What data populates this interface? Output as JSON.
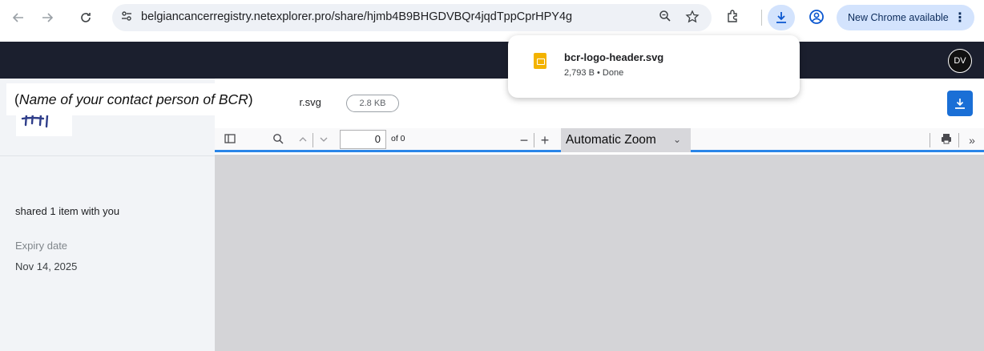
{
  "browser": {
    "url": "belgiancancerregistry.netexplorer.pro/share/hjmb4B9BHGDVBQr4jqdTppCprHPY4g",
    "new_chrome_label": "New Chrome available"
  },
  "download_popup": {
    "file_name": "bcr-logo-header.svg",
    "meta": "2,793 B • Done"
  },
  "header": {
    "avatar_initials": "DV"
  },
  "sidebar": {
    "contact_prefix": "(",
    "contact_name": "Name of your contact person of BCR",
    "contact_suffix": ")",
    "shared_text": "shared 1 item with you",
    "expiry_label": "Expiry date",
    "expiry_date": "Nov 14, 2025"
  },
  "file": {
    "name": "bcr-logo-header.svg",
    "size": "2.8 KB"
  },
  "pdf_toolbar": {
    "page_value": "0",
    "page_of": "of 0",
    "zoom": "Automatic Zoom"
  },
  "colors": {
    "accent": "#1a6fd6",
    "header_bg": "#1b1f2e",
    "toolbar_border": "#2a86e8",
    "canvas_bg": "#d4d4d7",
    "logo_stroke": "#2f3e8a"
  }
}
